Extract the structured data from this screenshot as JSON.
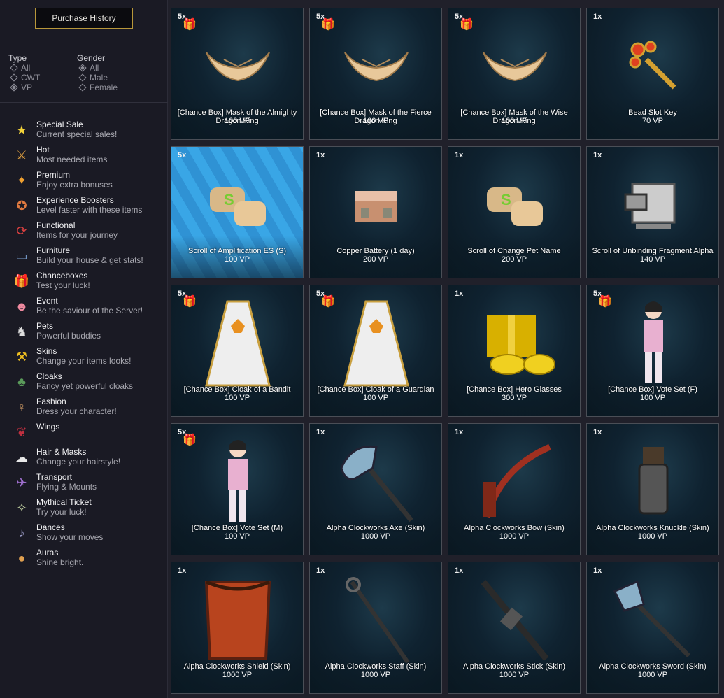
{
  "sidebar": {
    "purchase_history_label": "Purchase History",
    "type_filter": {
      "title": "Type",
      "options": [
        "All",
        "CWT",
        "VP"
      ],
      "selected": "VP"
    },
    "gender_filter": {
      "title": "Gender",
      "options": [
        "All",
        "Male",
        "Female"
      ],
      "selected": "All"
    },
    "categories": [
      {
        "name": "Special Sale",
        "desc": "Current special sales!",
        "icon": "special-sale-icon"
      },
      {
        "name": "Hot",
        "desc": "Most needed items",
        "icon": "hot-icon"
      },
      {
        "name": "Premium",
        "desc": "Enjoy extra bonuses",
        "icon": "premium-icon"
      },
      {
        "name": "Experience Boosters",
        "desc": "Level faster with these items",
        "icon": "experience-boosters-icon"
      },
      {
        "name": "Functional",
        "desc": "Items for your journey",
        "icon": "functional-icon"
      },
      {
        "name": "Furniture",
        "desc": "Build your house & get stats!",
        "icon": "furniture-icon"
      },
      {
        "name": "Chanceboxes",
        "desc": "Test your luck!",
        "icon": "chanceboxes-icon"
      },
      {
        "name": "Event",
        "desc": "Be the saviour of the Server!",
        "icon": "event-icon"
      },
      {
        "name": "Pets",
        "desc": "Powerful buddies",
        "icon": "pets-icon"
      },
      {
        "name": "Skins",
        "desc": "Change your items looks!",
        "icon": "skins-icon"
      },
      {
        "name": "Cloaks",
        "desc": "Fancy yet powerful cloaks",
        "icon": "cloaks-icon"
      },
      {
        "name": "Fashion",
        "desc": "Dress your character!",
        "icon": "fashion-icon"
      },
      {
        "name": "Wings",
        "desc": "",
        "icon": "wings-icon"
      },
      {
        "name": "Hair & Masks",
        "desc": "Change your hairstyle!",
        "icon": "hair-masks-icon"
      },
      {
        "name": "Transport",
        "desc": "Flying & Mounts",
        "icon": "transport-icon"
      },
      {
        "name": "Mythical Ticket",
        "desc": "Try your luck!",
        "icon": "mythical-ticket-icon"
      },
      {
        "name": "Dances",
        "desc": "Show your moves",
        "icon": "dances-icon"
      },
      {
        "name": "Auras",
        "desc": "Shine bright.",
        "icon": "auras-icon"
      }
    ]
  },
  "items": [
    {
      "qty": "5x",
      "gift": true,
      "name": "[Chance Box] Mask of the Almighty Dragon King",
      "price": "100 VP",
      "icon": "mask-icon"
    },
    {
      "qty": "5x",
      "gift": true,
      "name": "[Chance Box] Mask of the Fierce Dragon King",
      "price": "100 VP",
      "icon": "mask-icon"
    },
    {
      "qty": "5x",
      "gift": true,
      "name": "[Chance Box] Mask of the Wise Dragon King",
      "price": "100 VP",
      "icon": "mask-icon"
    },
    {
      "qty": "1x",
      "gift": false,
      "name": "Bead Slot Key",
      "price": "70 VP",
      "icon": "key-icon"
    },
    {
      "qty": "5x",
      "gift": false,
      "name": "Scroll of Amplification ES (S)",
      "price": "100 VP",
      "icon": "scroll-icon",
      "highlight": true
    },
    {
      "qty": "1x",
      "gift": false,
      "name": "Copper Battery (1 day)",
      "price": "200 VP",
      "icon": "battery-icon"
    },
    {
      "qty": "1x",
      "gift": false,
      "name": "Scroll of Change Pet Name",
      "price": "200 VP",
      "icon": "scroll-icon"
    },
    {
      "qty": "1x",
      "gift": false,
      "name": "Scroll of Unbinding Fragment Alpha",
      "price": "140 VP",
      "icon": "machine-icon"
    },
    {
      "qty": "5x",
      "gift": true,
      "name": "[Chance Box] Cloak of a Bandit",
      "price": "100 VP",
      "icon": "cloak-icon"
    },
    {
      "qty": "5x",
      "gift": true,
      "name": "[Chance Box] Cloak of a Guardian",
      "price": "100 VP",
      "icon": "cloak-icon"
    },
    {
      "qty": "1x",
      "gift": false,
      "name": "[Chance Box] Hero Glasses",
      "price": "300 VP",
      "icon": "gift-glasses-icon"
    },
    {
      "qty": "5x",
      "gift": true,
      "name": "[Chance Box] Vote Set (F)",
      "price": "100 VP",
      "icon": "character-icon"
    },
    {
      "qty": "5x",
      "gift": true,
      "name": "[Chance Box] Vote Set (M)",
      "price": "100 VP",
      "icon": "character-icon"
    },
    {
      "qty": "1x",
      "gift": false,
      "name": "Alpha Clockworks Axe (Skin)",
      "price": "1000 VP",
      "icon": "axe-icon"
    },
    {
      "qty": "1x",
      "gift": false,
      "name": "Alpha Clockworks Bow (Skin)",
      "price": "1000 VP",
      "icon": "bow-icon"
    },
    {
      "qty": "1x",
      "gift": false,
      "name": "Alpha Clockworks Knuckle (Skin)",
      "price": "1000 VP",
      "icon": "knuckle-icon"
    },
    {
      "qty": "1x",
      "gift": false,
      "name": "Alpha Clockworks Shield (Skin)",
      "price": "1000 VP",
      "icon": "shield-icon"
    },
    {
      "qty": "1x",
      "gift": false,
      "name": "Alpha Clockworks Staff (Skin)",
      "price": "1000 VP",
      "icon": "staff-icon"
    },
    {
      "qty": "1x",
      "gift": false,
      "name": "Alpha Clockworks Stick (Skin)",
      "price": "1000 VP",
      "icon": "stick-icon"
    },
    {
      "qty": "1x",
      "gift": false,
      "name": "Alpha Clockworks Sword (Skin)",
      "price": "1000 VP",
      "icon": "sword-icon"
    }
  ]
}
